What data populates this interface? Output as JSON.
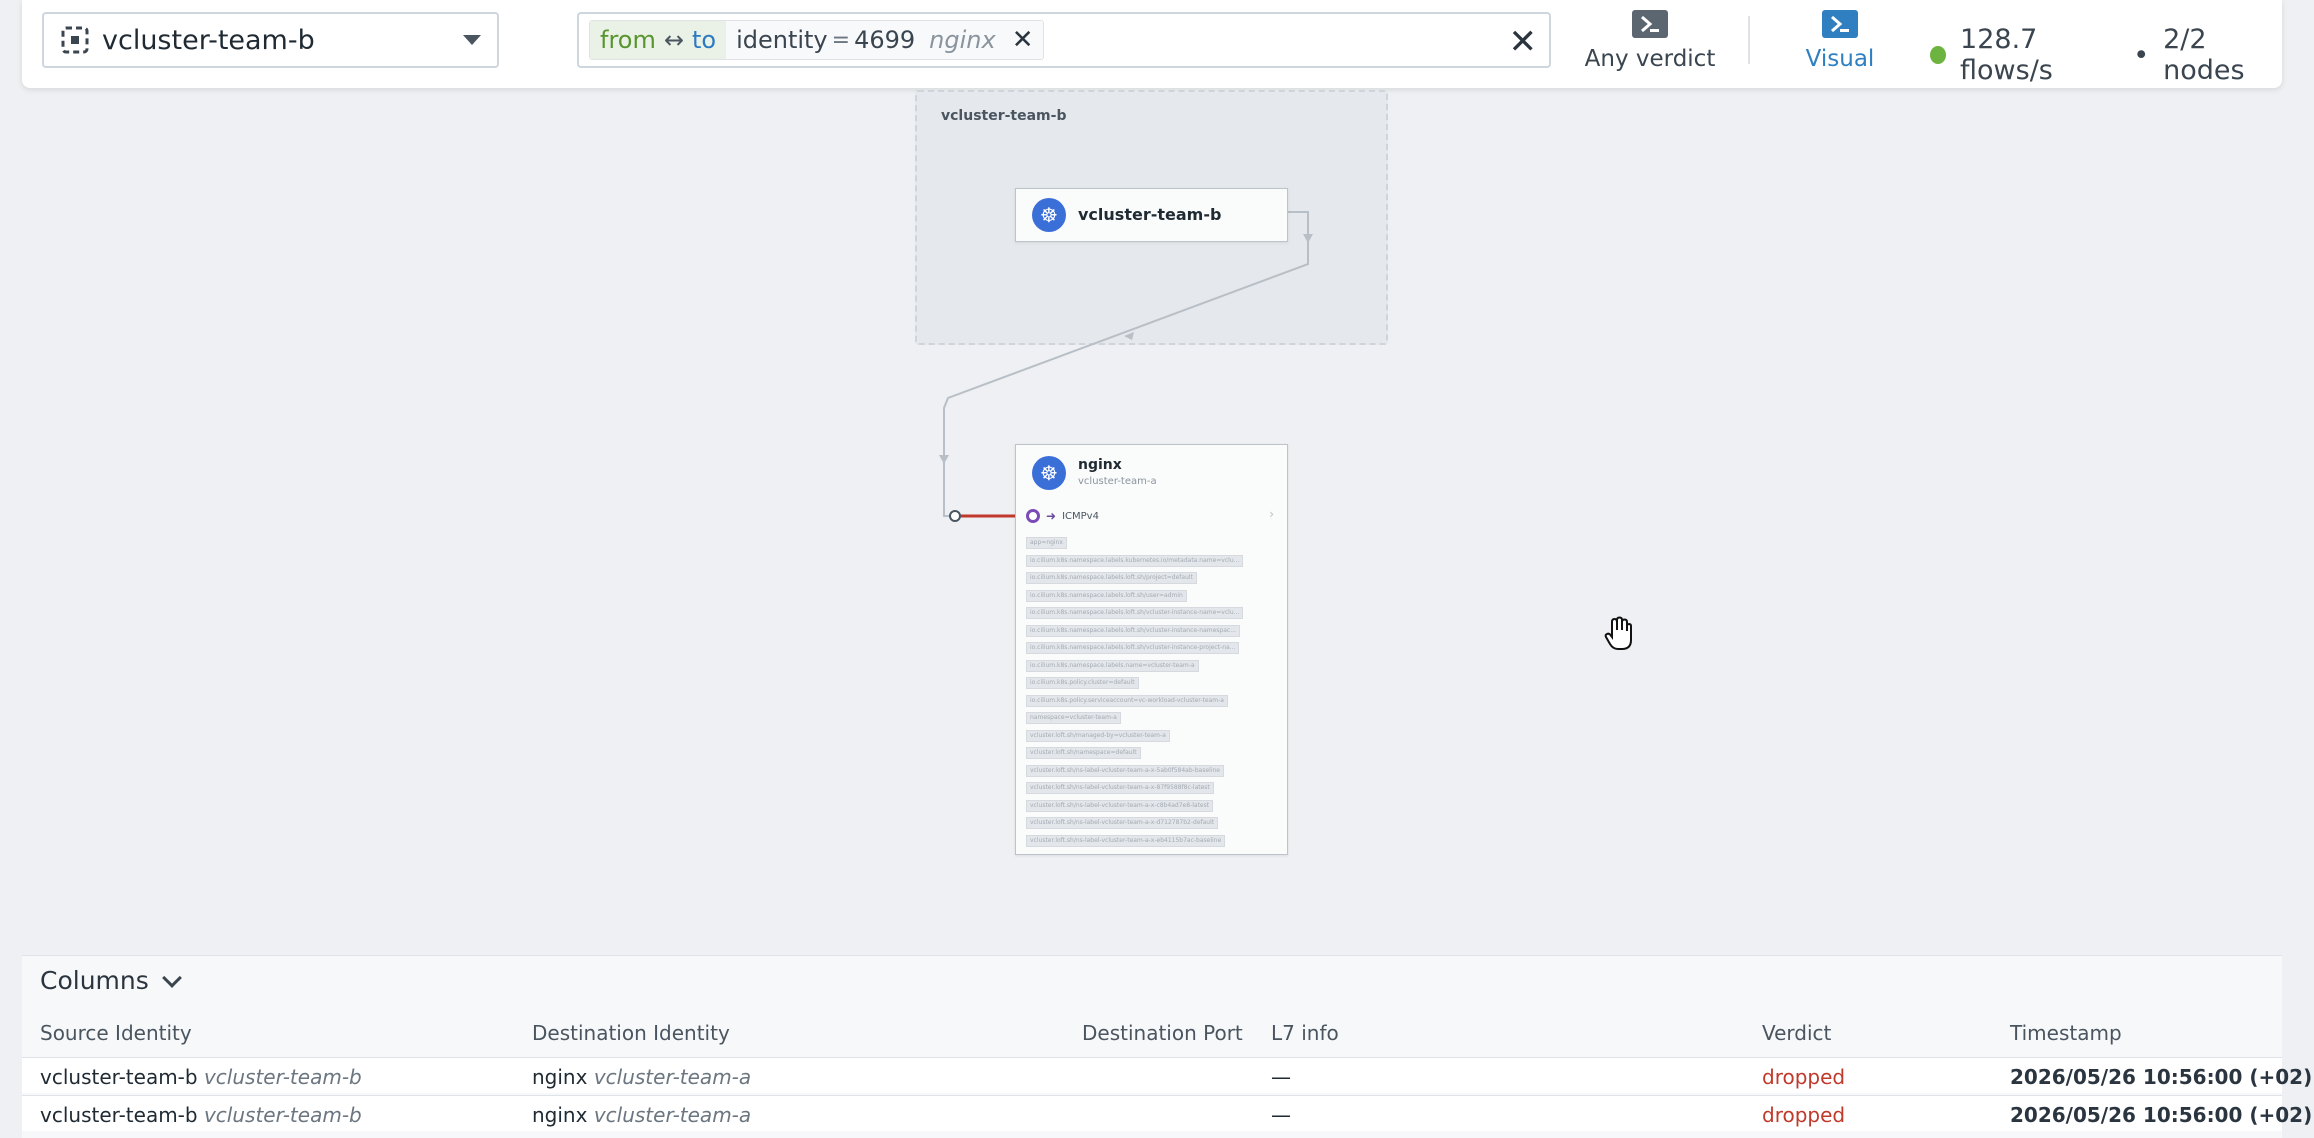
{
  "topbar": {
    "namespace": "vcluster-team-b",
    "filter": {
      "from": "from",
      "to": "to",
      "arrow": "↔",
      "key": "identity",
      "operator": "=",
      "value": "4699",
      "hint": "nginx",
      "remove": "✕"
    },
    "clear": "✕",
    "verdict_label": "Any verdict",
    "visual_label": "Visual",
    "flow_rate": "128.7 flows/s",
    "separator": "•",
    "nodes": "2/2 nodes",
    "status_color": "#6db33f"
  },
  "canvas": {
    "namespace_box_title": "vcluster-team-b",
    "vcluster_card": {
      "title": "vcluster-team-b",
      "icon": "kubernetes-icon"
    },
    "nginx_card": {
      "title": "nginx",
      "subtitle": "vcluster-team-a",
      "icon": "kubernetes-icon",
      "port": "ICMPv4",
      "labels": [
        "app=nginx",
        "io.cilium.k8s.namespace.labels.kubernetes.io/metadata.name=vclu...",
        "io.cilium.k8s.namespace.labels.loft.sh/project=default",
        "io.cilium.k8s.namespace.labels.loft.sh/user=admin",
        "io.cilium.k8s.namespace.labels.loft.sh/vcluster-instance-name=vclu...",
        "io.cilium.k8s.namespace.labels.loft.sh/vcluster-instance-namespac...",
        "io.cilium.k8s.namespace.labels.loft.sh/vcluster-instance-project-na...",
        "io.cilium.k8s.namespace.labels.name=vcluster-team-a",
        "io.cilium.k8s.policy.cluster=default",
        "io.cilium.k8s.policy.serviceaccount=vc-workload-vcluster-team-a",
        "namespace=vcluster-team-a",
        "vcluster.loft.sh/managed-by=vcluster-team-a",
        "vcluster.loft.sh/namespace=default",
        "vcluster.loft.sh/ns-label-vcluster-team-a-x-5ab0f584ab-baseline",
        "vcluster.loft.sh/ns-label-vcluster-team-a-x-87f9588f8c-latest",
        "vcluster.loft.sh/ns-label-vcluster-team-a-x-c8b4ad7e8-latest",
        "vcluster.loft.sh/ns-label-vcluster-team-a-x-d712787b2-default",
        "vcluster.loft.sh/ns-label-vcluster-team-a-x-eb4115b7ac-baseline"
      ]
    },
    "edge_colors": {
      "normal": "#b8bfc6",
      "dropped": "#c0392b"
    }
  },
  "flows": {
    "columns_toggle": "Columns",
    "headers": {
      "source": "Source Identity",
      "destination": "Destination Identity",
      "dest_port": "Destination Port",
      "l7": "L7 info",
      "verdict": "Verdict",
      "timestamp": "Timestamp"
    },
    "rows": [
      {
        "source_name": "vcluster-team-b",
        "source_ns": "vcluster-team-b",
        "dest_name": "nginx",
        "dest_ns": "vcluster-team-a",
        "dest_port": "",
        "l7": "—",
        "verdict": "dropped",
        "timestamp": "2026/05/26 10:56:00 (+02)"
      },
      {
        "source_name": "vcluster-team-b",
        "source_ns": "vcluster-team-b",
        "dest_name": "nginx",
        "dest_ns": "vcluster-team-a",
        "dest_port": "",
        "l7": "—",
        "verdict": "dropped",
        "timestamp": "2026/05/26 10:56:00 (+02)"
      }
    ]
  }
}
